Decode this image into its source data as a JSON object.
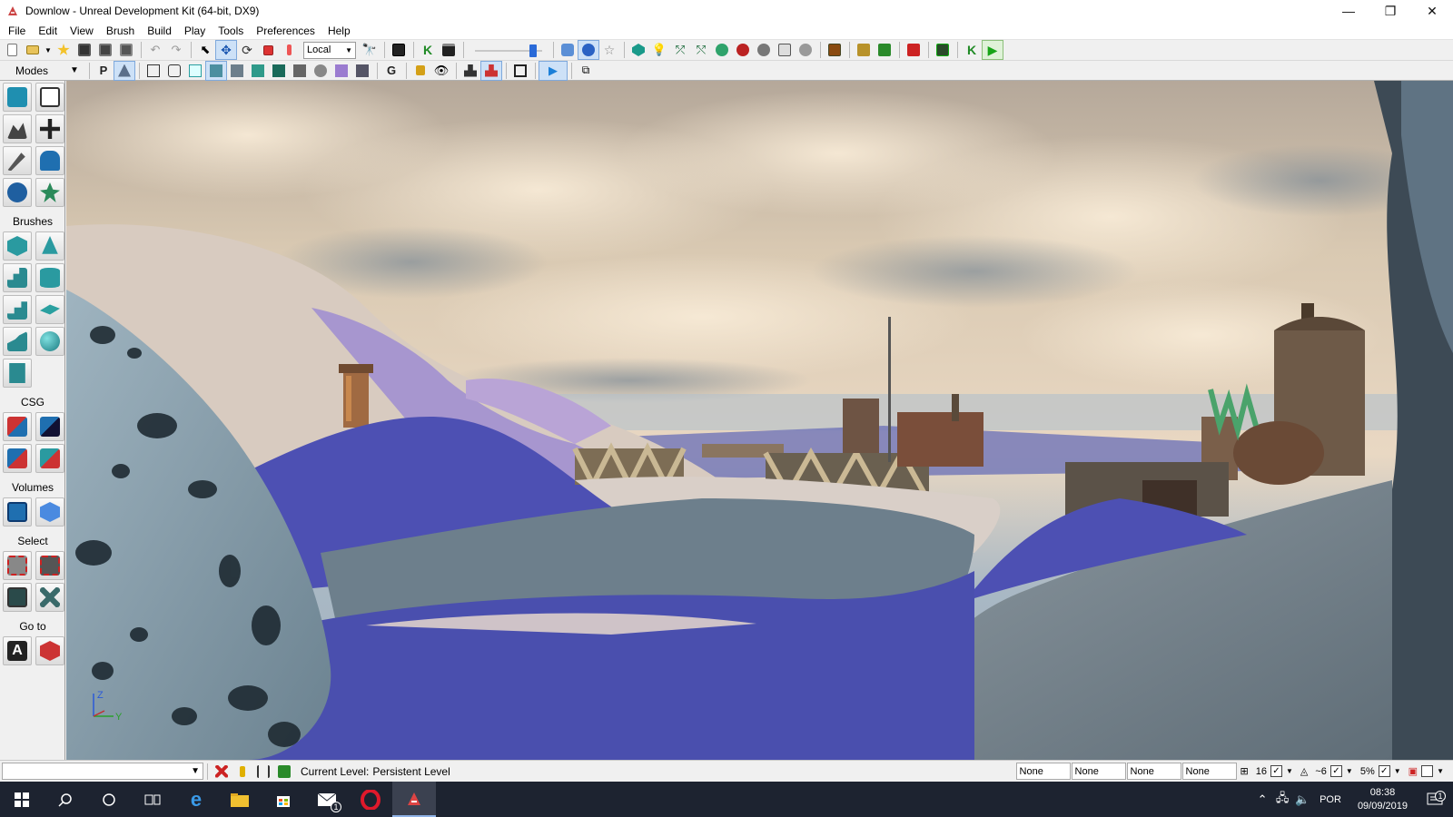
{
  "window": {
    "title": "Downlow - Unreal Development Kit (64-bit, DX9)",
    "controls": {
      "minimize": "—",
      "restore": "❐",
      "close": "✕"
    }
  },
  "menubar": [
    "File",
    "Edit",
    "View",
    "Brush",
    "Build",
    "Play",
    "Tools",
    "Preferences",
    "Help"
  ],
  "toolbar": {
    "coordinate_system": "Local",
    "icons": [
      "new-icon",
      "open-icon",
      "favorites-icon",
      "save-icon",
      "save-all-icon",
      "save-as-icon",
      "undo-icon",
      "redo-icon",
      "select-icon",
      "translate-icon",
      "rotate-icon",
      "scale-icon",
      "nonuniform-scale-icon",
      "find-icon",
      "kismet-icon",
      "content-browser-icon",
      "matinee-icon",
      "camera-speed-slider",
      "realtime-icon",
      "lighting-icon",
      "bookmark-icon",
      "build-geometry-icon",
      "build-lighting-icon",
      "build-paths-icon",
      "build-cover-icon",
      "build-all-icon",
      "play-in-editor-icon"
    ]
  },
  "viewport_toolbar": {
    "modes_label": "Modes",
    "letters": {
      "perspective": "P",
      "game": "G"
    },
    "active_mode": "lit"
  },
  "modes_panel": {
    "sections": [
      "Brushes",
      "CSG",
      "Volumes",
      "Select",
      "Go to"
    ]
  },
  "viewport": {
    "axis": {
      "z": "Z",
      "y": "Y"
    },
    "colors": {
      "sky_top": "#c9c0b4",
      "cloud": "#f2e3cc",
      "sand": "#d9cfc8",
      "blue_terrain": "#4a4fae",
      "lavender": "#9b89c9",
      "grey_terrain": "#6d7f8c"
    }
  },
  "statusbar": {
    "current_level_label": "Current Level:",
    "current_level_value": "Persistent Level",
    "layer_fields": [
      "None",
      "None",
      "None",
      "None"
    ],
    "grid_value": "16",
    "rotation_snap": "~6",
    "scale_snap": "5%"
  },
  "taskbar": {
    "language": "POR",
    "time": "08:38",
    "date": "09/09/2019",
    "notification_count": "1",
    "mail_badge": "1"
  }
}
